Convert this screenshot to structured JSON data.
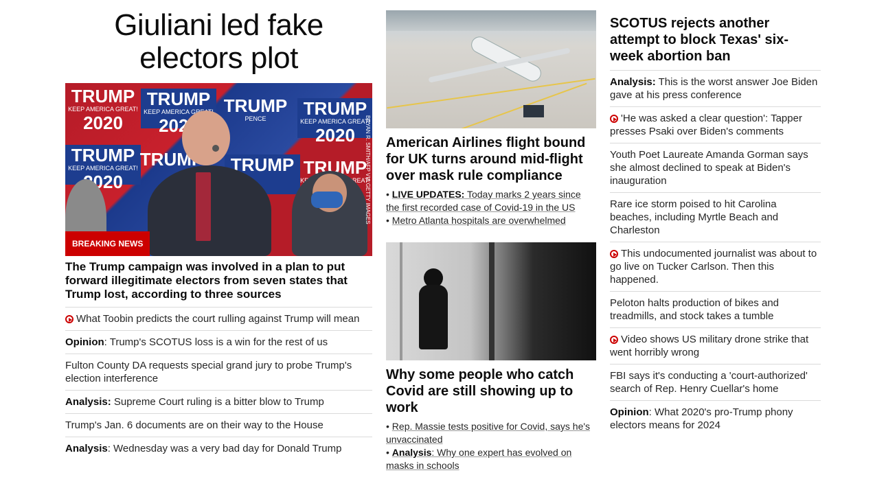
{
  "col1": {
    "headline": "Giuliani led fake electors plot",
    "image": {
      "badge": "BREAKING NEWS",
      "credit": "BRYAN R. SMITH/AFP VIA GETTY IMAGES",
      "sign_text": "TRUMP",
      "sign_year": "2020",
      "sign_slogan": "KEEP AMERICA GREAT!",
      "sign_pence": "PENCE"
    },
    "lead": "The Trump campaign was involved in a plan to put forward illegitimate electors from seven states that Trump lost, according to three sources",
    "items": [
      {
        "prefix": "",
        "text": "What Toobin predicts the court rulling against Trump will mean"
      },
      {
        "prefix": "Opinion",
        "text": ": Trump's SCOTUS loss is a win for the rest of us"
      },
      {
        "prefix": "",
        "text": "Fulton County DA requests special grand jury to probe Trump's election interference"
      },
      {
        "prefix": "Analysis:",
        "text": " Supreme Court ruling is a bitter blow to Trump"
      },
      {
        "prefix": "",
        "text": "Trump's Jan. 6 documents are on their way to the House"
      },
      {
        "prefix": "Analysis",
        "text": ": Wednesday was a very bad day for Donald Trump"
      }
    ]
  },
  "col2": {
    "story1": {
      "headline": "American Airlines flight bound for UK turns around mid-flight over mask rule compliance",
      "sub1_prefix": "LIVE UPDATES:",
      "sub1_text": " Today marks 2 years since the first recorded case of Covid-19 in the US",
      "sub2_text": "Metro Atlanta hospitals are overwhelmed"
    },
    "story2": {
      "headline": "Why some people who catch Covid are still showing up to work",
      "sub1_text": "Rep. Massie tests positive for Covid, says he's unvaccinated",
      "sub2_prefix": "Analysis",
      "sub2_text": ": Why one expert has evolved on masks in schools"
    }
  },
  "col3": {
    "headline": "SCOTUS rejects another attempt to block Texas' six-week abortion ban",
    "items": [
      {
        "prefix": "Analysis:",
        "text": " This is the worst answer Joe Biden gave at his press conference"
      },
      {
        "prefix": "",
        "text": "'He was asked a clear question': Tapper presses Psaki over Biden's comments"
      },
      {
        "prefix": "",
        "text": "Youth Poet Laureate Amanda Gorman says she almost declined to speak at Biden's inauguration"
      },
      {
        "prefix": "",
        "text": "Rare ice storm poised to hit Carolina beaches, including Myrtle Beach and Charleston"
      },
      {
        "prefix": "",
        "text": "This undocumented journalist was about to go live on Tucker Carlson. Then this happened."
      },
      {
        "prefix": "",
        "text": "Peloton halts production of bikes and treadmills, and stock takes a tumble"
      },
      {
        "prefix": "",
        "text": "Video shows US military drone strike that went horribly wrong"
      },
      {
        "prefix": "",
        "text": "FBI says it's conducting a 'court-authorized' search of Rep. Henry Cuellar's home"
      },
      {
        "prefix": "Opinion",
        "text": ": What 2020's pro-Trump phony electors means for 2024"
      }
    ]
  },
  "colors": {
    "accent": "#cc0000",
    "divider": "#dadada",
    "text": "#0c0c0c"
  }
}
